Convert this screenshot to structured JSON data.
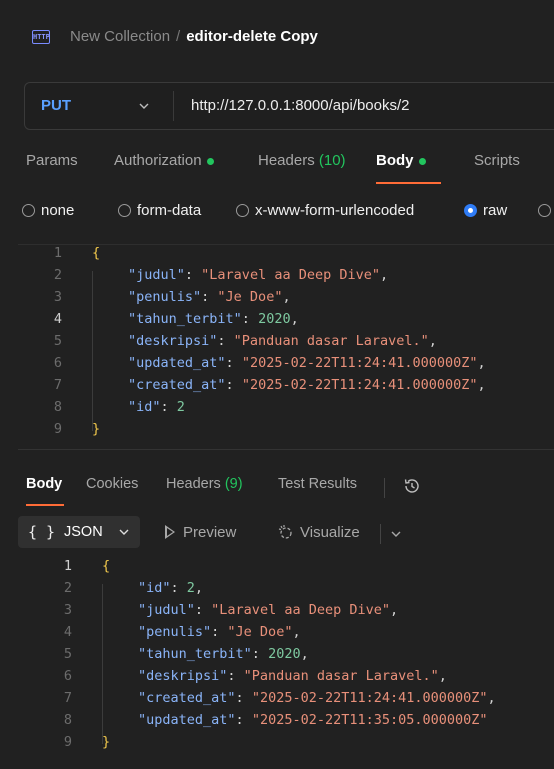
{
  "header": {
    "icon": "http-icon",
    "icon_label": "HTTP",
    "collection": "New Collection",
    "separator": "/",
    "request_name": "editor-delete Copy"
  },
  "urlbar": {
    "method": "PUT",
    "url": "http://127.0.0.1:8000/api/books/2"
  },
  "request_tabs": [
    {
      "label": "Params"
    },
    {
      "label": "Authorization"
    },
    {
      "label": "Headers",
      "count": "(10)"
    },
    {
      "label": "Body"
    },
    {
      "label": "Scripts"
    }
  ],
  "body_types": [
    {
      "label": "none",
      "selected": false
    },
    {
      "label": "form-data",
      "selected": false
    },
    {
      "label": "x-www-form-urlencoded",
      "selected": false
    },
    {
      "label": "raw",
      "selected": true
    }
  ],
  "request_body": {
    "line_numbers": [
      "1",
      "2",
      "3",
      "4",
      "5",
      "6",
      "7",
      "8",
      "9"
    ],
    "open_brace": "{",
    "close_brace": "}",
    "fields": [
      {
        "key": "\"judul\"",
        "value": "\"Laravel aa Deep Dive\"",
        "type": "string",
        "comma": ","
      },
      {
        "key": "\"penulis\"",
        "value": "\"Je Doe\"",
        "type": "string",
        "comma": ","
      },
      {
        "key": "\"tahun_terbit\"",
        "value": "2020",
        "type": "number",
        "comma": ","
      },
      {
        "key": "\"deskripsi\"",
        "value": "\"Panduan dasar Laravel.\"",
        "type": "string",
        "comma": ","
      },
      {
        "key": "\"updated_at\"",
        "value": "\"2025-02-22T11:24:41.000000Z\"",
        "type": "string",
        "comma": ","
      },
      {
        "key": "\"created_at\"",
        "value": "\"2025-02-22T11:24:41.000000Z\"",
        "type": "string",
        "comma": ","
      },
      {
        "key": "\"id\"",
        "value": "2",
        "type": "number",
        "comma": ""
      }
    ]
  },
  "response_tabs": [
    {
      "label": "Body"
    },
    {
      "label": "Cookies"
    },
    {
      "label": "Headers",
      "count": "(9)"
    },
    {
      "label": "Test Results"
    }
  ],
  "response_toolbar": {
    "format_brace": "{ }",
    "format": "JSON",
    "preview": "Preview",
    "visualize": "Visualize"
  },
  "response_body": {
    "line_numbers": [
      "1",
      "2",
      "3",
      "4",
      "5",
      "6",
      "7",
      "8",
      "9"
    ],
    "open_brace": "{",
    "close_brace": "}",
    "fields": [
      {
        "key": "\"id\"",
        "value": "2",
        "type": "number",
        "comma": ","
      },
      {
        "key": "\"judul\"",
        "value": "\"Laravel aa Deep Dive\"",
        "type": "string",
        "comma": ","
      },
      {
        "key": "\"penulis\"",
        "value": "\"Je Doe\"",
        "type": "string",
        "comma": ","
      },
      {
        "key": "\"tahun_terbit\"",
        "value": "2020",
        "type": "number",
        "comma": ","
      },
      {
        "key": "\"deskripsi\"",
        "value": "\"Panduan dasar Laravel.\"",
        "type": "string",
        "comma": ","
      },
      {
        "key": "\"created_at\"",
        "value": "\"2025-02-22T11:24:41.000000Z\"",
        "type": "string",
        "comma": ","
      },
      {
        "key": "\"updated_at\"",
        "value": "\"2025-02-22T11:35:05.000000Z\"",
        "type": "string",
        "comma": ""
      }
    ]
  },
  "colors": {
    "accent": "#ff6c37",
    "status_green": "#22c55e",
    "method_blue": "#5aa0ff",
    "radio_blue": "#2f7cf6"
  }
}
